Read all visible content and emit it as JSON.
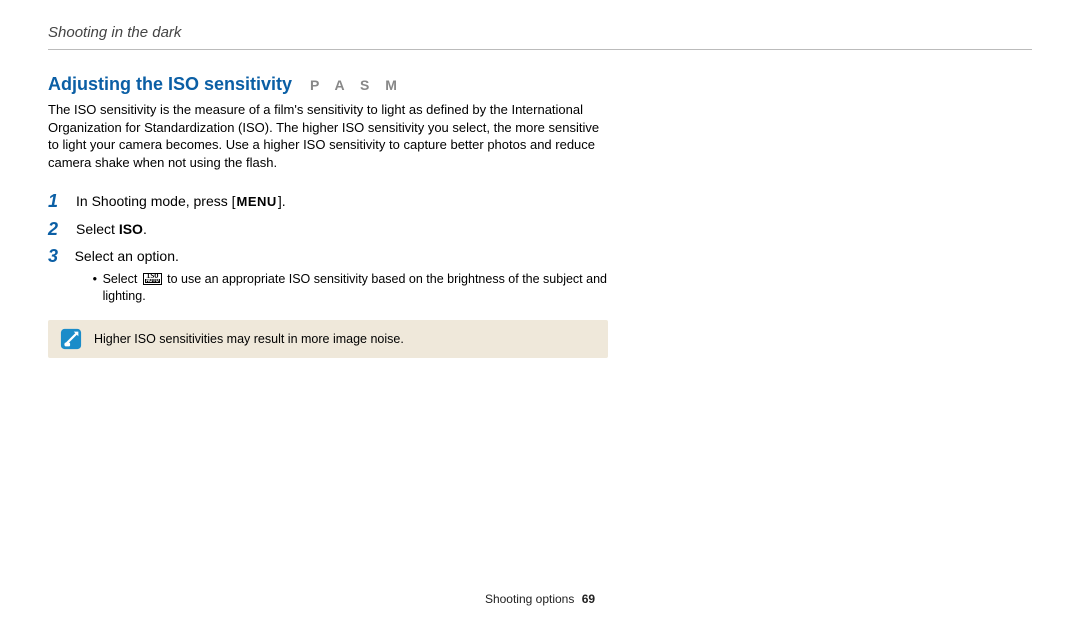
{
  "breadcrumb": "Shooting in the dark",
  "heading": "Adjusting the ISO sensitivity",
  "modes": "P A S M",
  "intro": "The ISO sensitivity is the measure of a film's sensitivity to light as defined by the International Organization for Standardization (ISO). The higher ISO sensitivity you select, the more sensitive to light your camera becomes. Use a higher ISO sensitivity to capture better photos and reduce camera shake when not using the flash.",
  "steps": {
    "s1": {
      "num": "1",
      "prefix": "In Shooting mode, press [",
      "icon_name": "menu-icon",
      "icon_text": "MENU",
      "suffix": "]."
    },
    "s2": {
      "num": "2",
      "prefix": "Select ",
      "bold": "ISO",
      "suffix": "."
    },
    "s3": {
      "num": "3",
      "text": "Select an option.",
      "sub": {
        "prefix": "Select ",
        "icon_top": "ISO",
        "icon_bottom": "AUTO",
        "suffix": " to use an appropriate ISO sensitivity based on the brightness of the subject and lighting."
      }
    }
  },
  "note": {
    "text": "Higher ISO sensitivities may result in more image noise."
  },
  "footer": {
    "section": "Shooting options",
    "page": "69"
  }
}
